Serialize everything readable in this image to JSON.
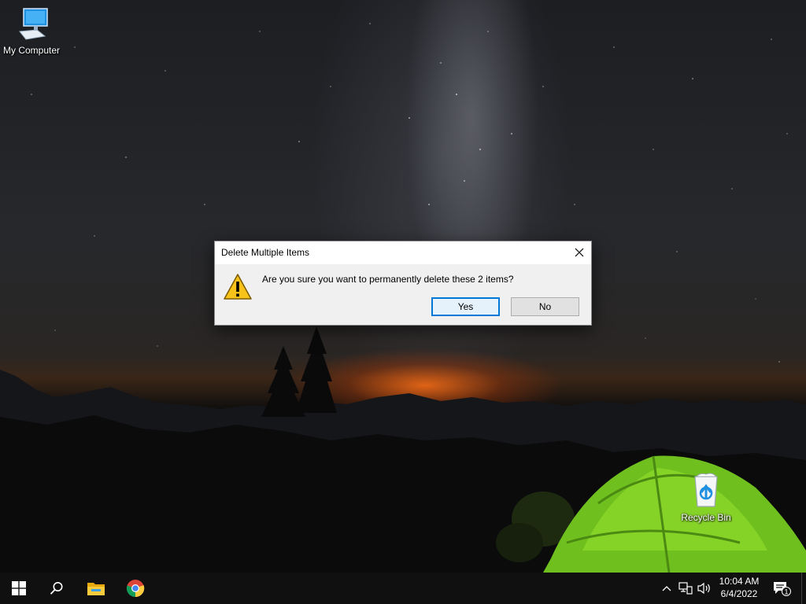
{
  "desktop": {
    "icons": [
      {
        "label": "My Computer",
        "icon": "computer-icon"
      },
      {
        "label": "Recycle Bin",
        "icon": "recycle-bin-icon"
      }
    ]
  },
  "dialog": {
    "title": "Delete Multiple Items",
    "message": "Are you sure you want to permanently delete these 2 items?",
    "icon": "warning-icon",
    "buttons": {
      "yes_label": "Yes",
      "no_label": "No"
    },
    "accent_color": "#0078d7"
  },
  "taskbar": {
    "pinned": [
      "windows-start-icon",
      "search-icon",
      "file-explorer-icon",
      "chrome-icon"
    ],
    "clock": {
      "time": "10:04 AM",
      "date": "6/4/2022"
    },
    "notifications_count": "1"
  }
}
